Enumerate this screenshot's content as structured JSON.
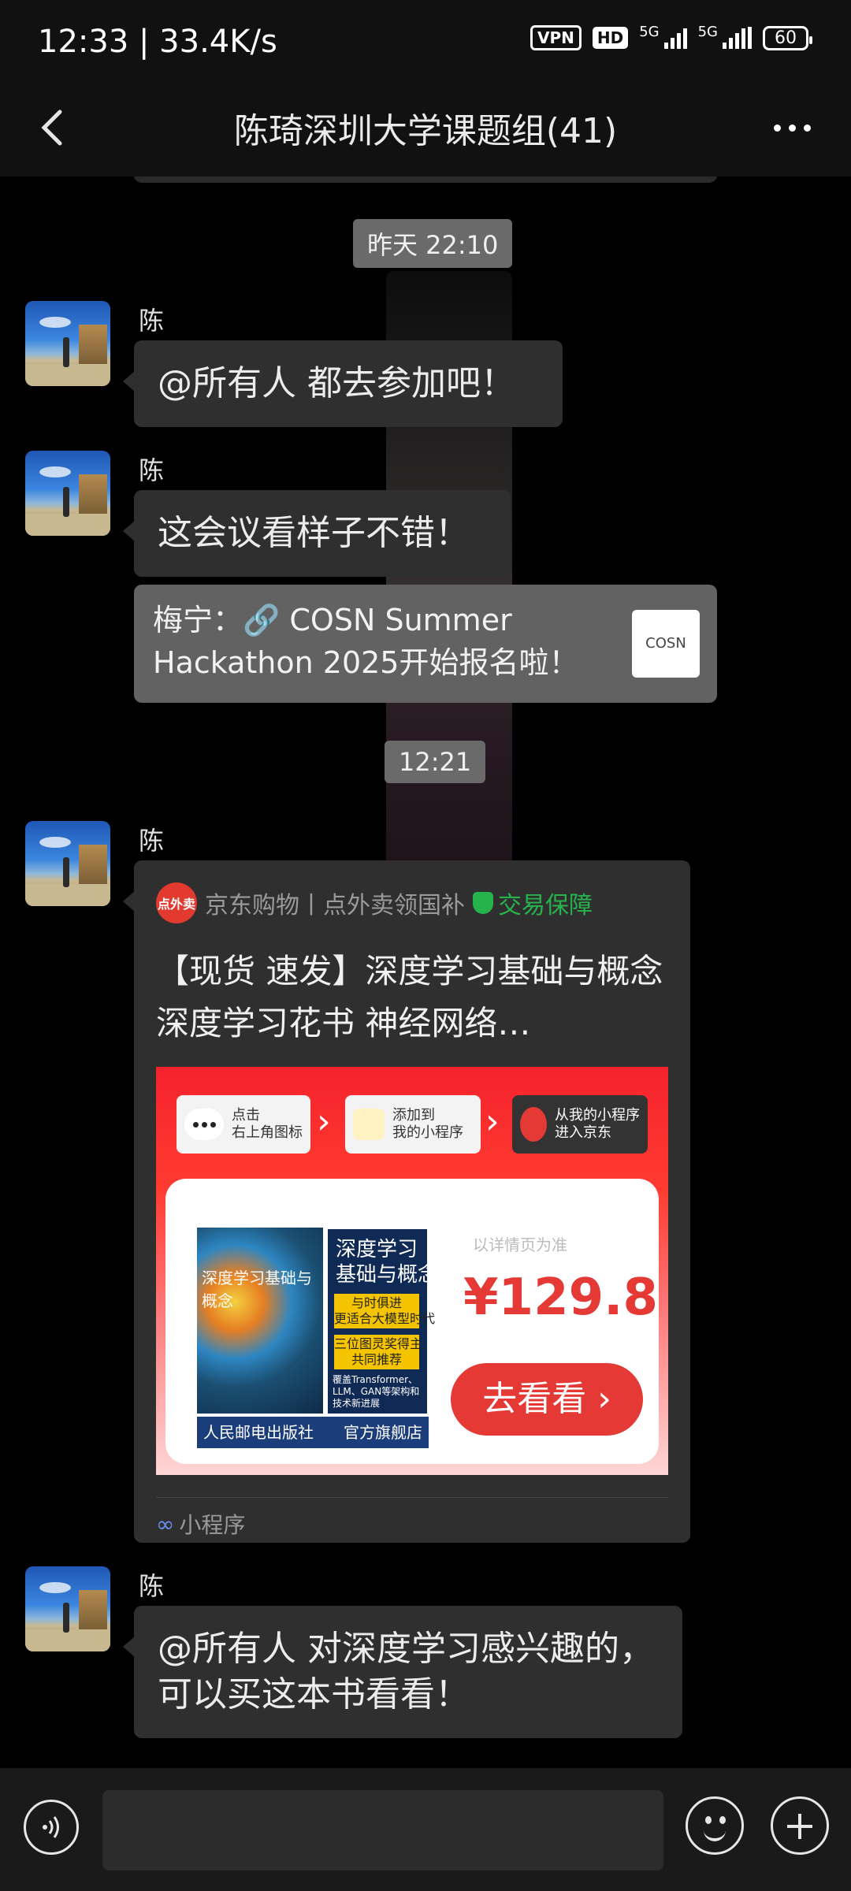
{
  "status_bar": {
    "time_speed": "12:33 | 33.4K/s",
    "vpn": "VPN",
    "hd": "HD",
    "net1": "5G",
    "net2": "5G",
    "battery": "60"
  },
  "header": {
    "title": "陈琦深圳大学课题组(41)"
  },
  "messages": [
    {
      "type": "time",
      "text": "昨天 22:10"
    },
    {
      "type": "text",
      "sender": "陈琦",
      "text": "@所有人  都去参加吧！"
    },
    {
      "type": "text",
      "sender": "陈琦",
      "text": "这会议看样子不错！"
    },
    {
      "type": "link_quote",
      "text": "梅宁：🔗 COSN Summer Hackathon 2025开始报名啦！",
      "thumb_label": "COSN"
    },
    {
      "type": "time",
      "text": "12:21"
    },
    {
      "type": "mini_program",
      "sender": "陈琦"
    },
    {
      "type": "text",
      "sender": "陈琦",
      "text": "@所有人  对深度学习感兴趣的，可以买这本书看看！"
    }
  ],
  "mini_program": {
    "logo_text": "点外卖",
    "source": "京东购物丨点外卖领国补",
    "guarantee": "交易保障",
    "title": "【现货 速发】深度学习基础与概念 深度学习花书 神经网络…",
    "steps": [
      {
        "label": "点击\n右上角图标"
      },
      {
        "label": "添加到\n我的小程序"
      },
      {
        "label": "从我的小程序\n进入京东"
      }
    ],
    "book": {
      "cover_title": "深度学习基础与概念",
      "side_title": "深度学习\n基础与概念",
      "tag1": "与时俱进\n更适合大模型时代",
      "tag2": "三位图灵奖得主\n共同推荐",
      "tag3": "覆盖Transformer、LLM、GAN等架构和技术新进展",
      "publisher": "人民邮电出版社",
      "store": "官方旗舰店"
    },
    "price_note": "以详情页为准",
    "price": "¥129.8",
    "button": "去看看 ›",
    "footer": "小程序"
  },
  "input_bar": {
    "placeholder": ""
  },
  "icons": [
    "back-icon",
    "more-icon",
    "voice-icon",
    "emoji-icon",
    "plus-icon",
    "link-icon",
    "shield-icon",
    "mini-program-icon"
  ]
}
